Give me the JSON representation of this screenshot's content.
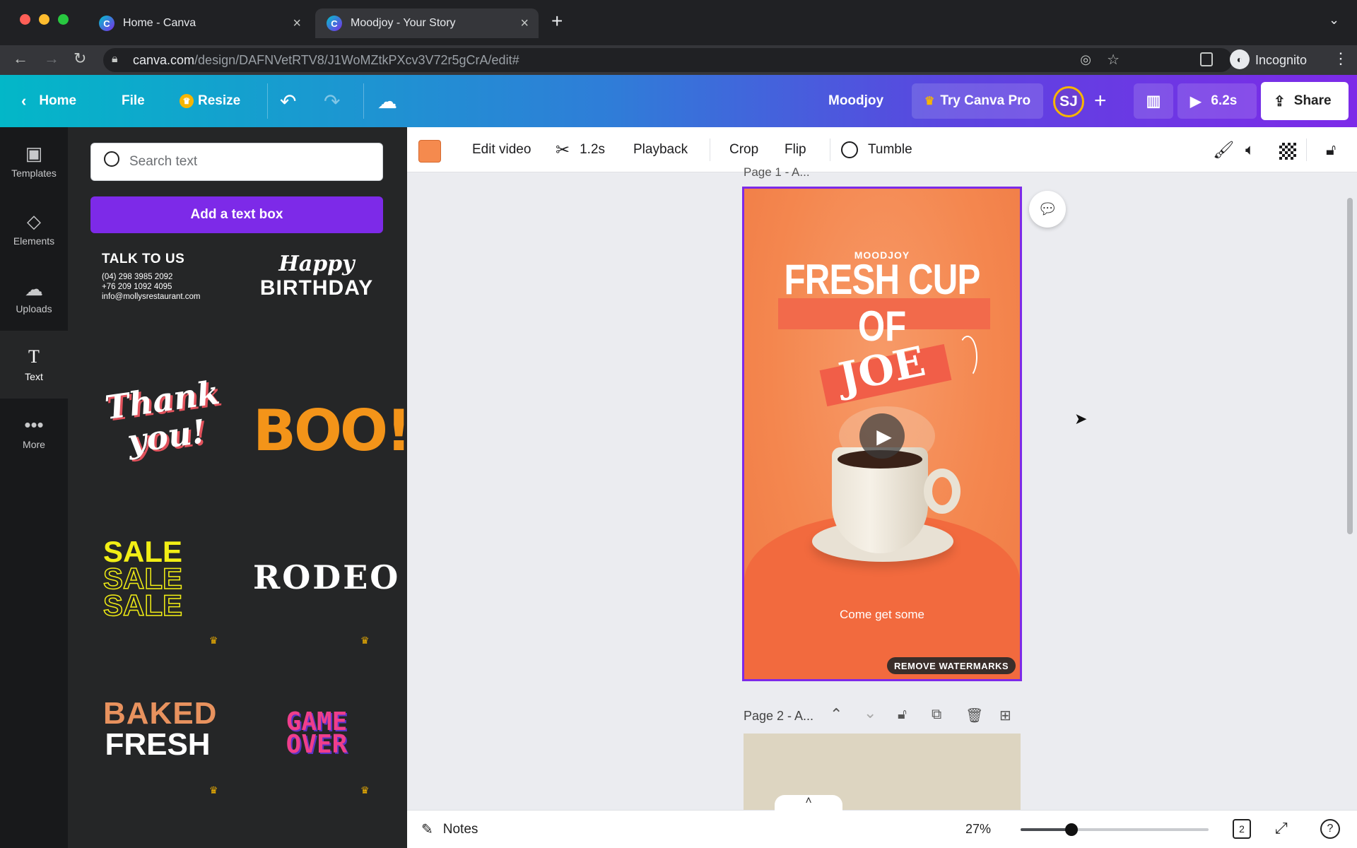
{
  "browser": {
    "tabs": [
      {
        "label": "Home - Canva"
      },
      {
        "label": "Moodjoy - Your Story"
      }
    ],
    "url_host": "canva.com",
    "url_path": "/design/DAFNVetRTV8/J1WoMZtkPXcv3V72r5gCrA/edit#",
    "incognito_label": "Incognito"
  },
  "header": {
    "home": "Home",
    "file": "File",
    "resize": "Resize",
    "design_name": "Moodjoy",
    "try_pro": "Try Canva Pro",
    "avatar": "SJ",
    "play_duration": "6.2s",
    "share": "Share"
  },
  "rail": [
    {
      "label": "Templates"
    },
    {
      "label": "Elements"
    },
    {
      "label": "Uploads"
    },
    {
      "label": "Text"
    },
    {
      "label": "More"
    }
  ],
  "panel": {
    "search_placeholder": "Search text",
    "add_text_box": "Add a text box",
    "talk_to_us": {
      "title": "TALK TO US",
      "line1": "(04) 298 3985 2092",
      "line2": "+76 209 1092 4095",
      "line3": "info@mollysrestaurant.com"
    },
    "happy_birthday": {
      "line1": "Happy",
      "line2": "BIRTHDAY"
    },
    "thank_you": {
      "line1": "Thank",
      "line2": "you!"
    },
    "boo": "BOO!",
    "sale": "SALE",
    "rodeo": "RODEO",
    "baked_fresh": {
      "line1": "BAKED",
      "line2": "FRESH"
    },
    "game_over": {
      "line1": "GAME",
      "line2": "OVER"
    }
  },
  "toolbar": {
    "color": "#f58a4e",
    "edit_video": "Edit video",
    "duration": "1.2s",
    "playback": "Playback",
    "crop": "Crop",
    "flip": "Flip",
    "tumble": "Tumble"
  },
  "canvas": {
    "page1": {
      "label": "Page 1 - A...",
      "brand": "MOODJOY",
      "line1": "FRESH CUP",
      "line2": "OF",
      "line3": "JOE",
      "tagline": "Come get some",
      "watermark": "REMOVE WATERMARKS"
    },
    "page2": {
      "label": "Page 2 - A..."
    }
  },
  "footer": {
    "notes": "Notes",
    "zoom": "27%",
    "zoom_fraction": 0.27,
    "page_count": "2"
  }
}
